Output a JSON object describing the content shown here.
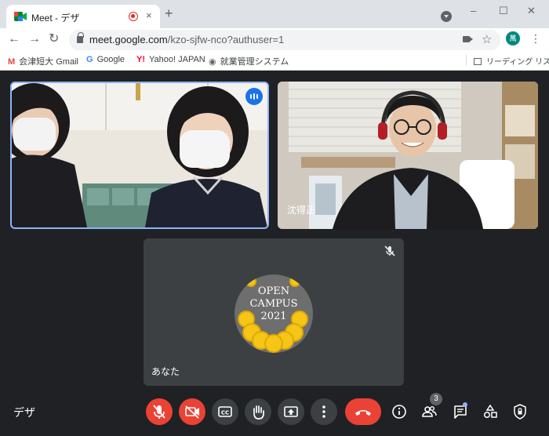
{
  "tab": {
    "title": "Meet - デザ",
    "close": "×"
  },
  "newtab": "+",
  "window": {
    "minimize": "–",
    "maximize": "☐",
    "close": "✕"
  },
  "nav": {
    "back": "←",
    "forward": "→",
    "reload": "↻"
  },
  "address": {
    "host": "meet.google.com",
    "path": "/kzo-sjfw-nco?authuser=1"
  },
  "profile": {
    "initial": "萬"
  },
  "bookmarks": [
    {
      "icon": "M",
      "label": "会津短大 Gmail",
      "color": "#ea4335"
    },
    {
      "icon": "G",
      "label": "Google",
      "color": "#4285f4"
    },
    {
      "icon": "Y!",
      "label": "Yahoo! JAPAN",
      "color": "#ff0033"
    },
    {
      "icon": "◉",
      "label": "就業管理システム",
      "color": "#5f6368"
    }
  ],
  "reading_list": "リーディング リスト",
  "participants": [
    {
      "name": ""
    },
    {
      "name": "沈得正"
    },
    {
      "name": "あなた"
    }
  ],
  "logo": {
    "line1": "OPEN",
    "line2": "CAMPUS",
    "line3": "2021"
  },
  "meeting_name": "デザ",
  "people_count": "3",
  "colors": {
    "accent": "#8ab4f8",
    "danger": "#ea4335",
    "surface": "#3c4043",
    "background": "#202124"
  }
}
